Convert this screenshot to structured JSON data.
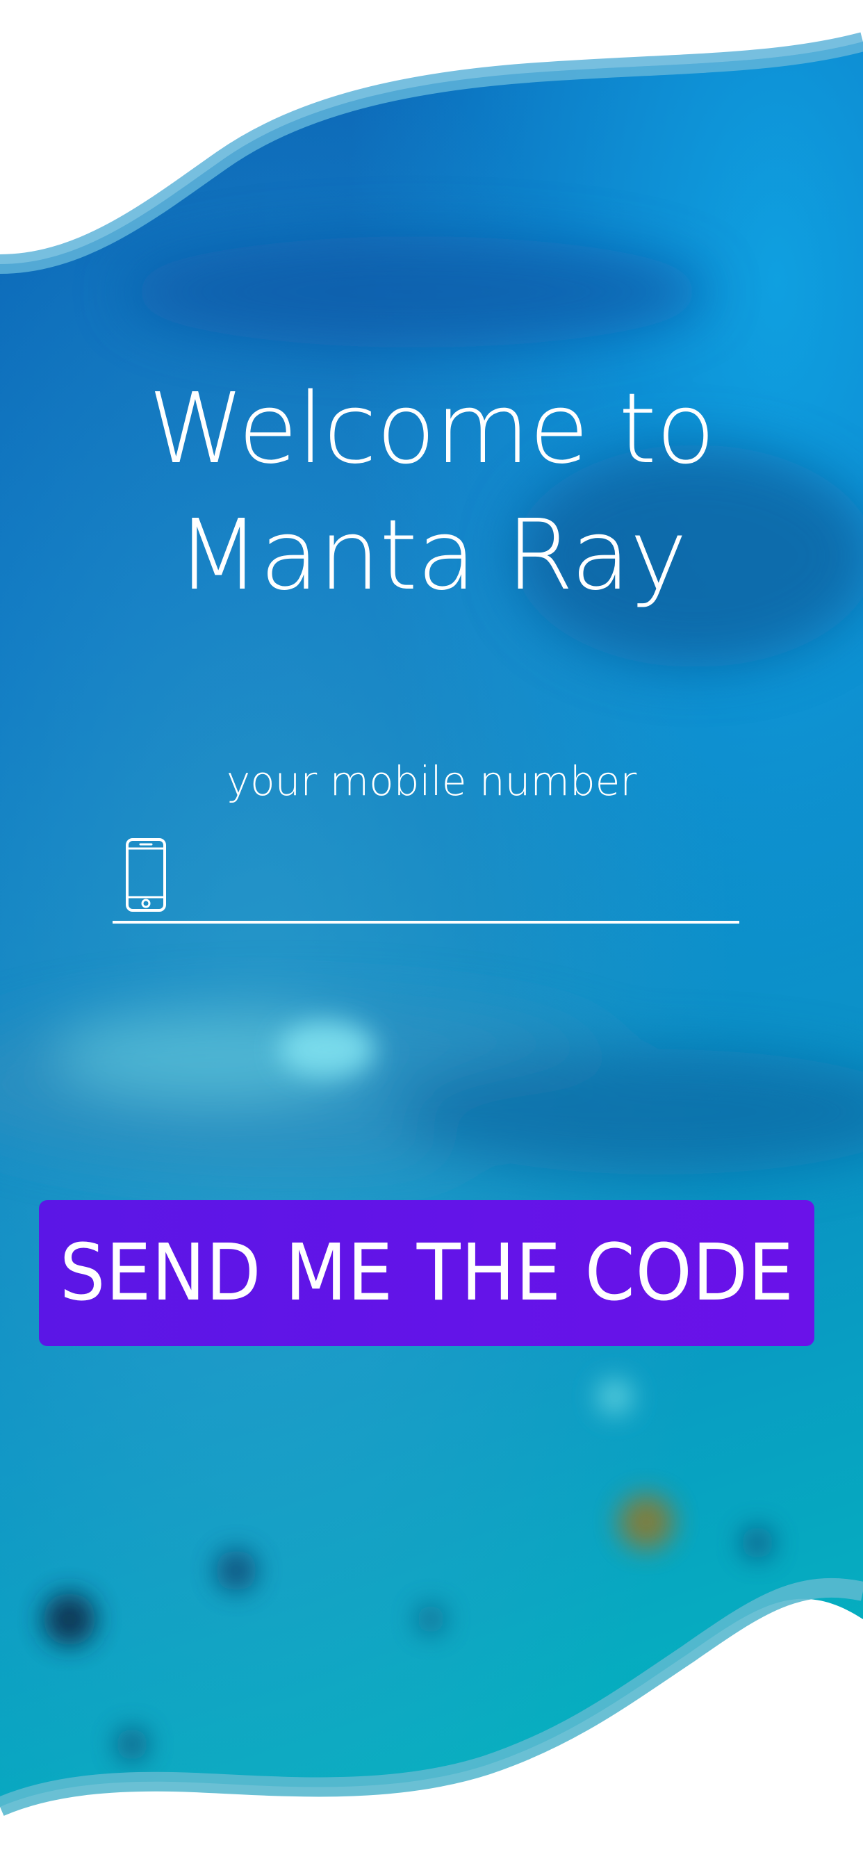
{
  "screen": {
    "title_line_1": "Welcome to",
    "title_line_2": "Manta Ray"
  },
  "phone": {
    "label": "your mobile number",
    "value": "",
    "placeholder": "",
    "icon": "smartphone-icon"
  },
  "actions": {
    "send_code_label": "SEND ME THE CODE"
  },
  "colors": {
    "background_top": "#0a6cbf",
    "background_mid": "#0b78c4",
    "background_bottom": "#06a7c0",
    "wave_border": "#5db6d8",
    "button": "#6214e8",
    "text": "#ffffff"
  }
}
